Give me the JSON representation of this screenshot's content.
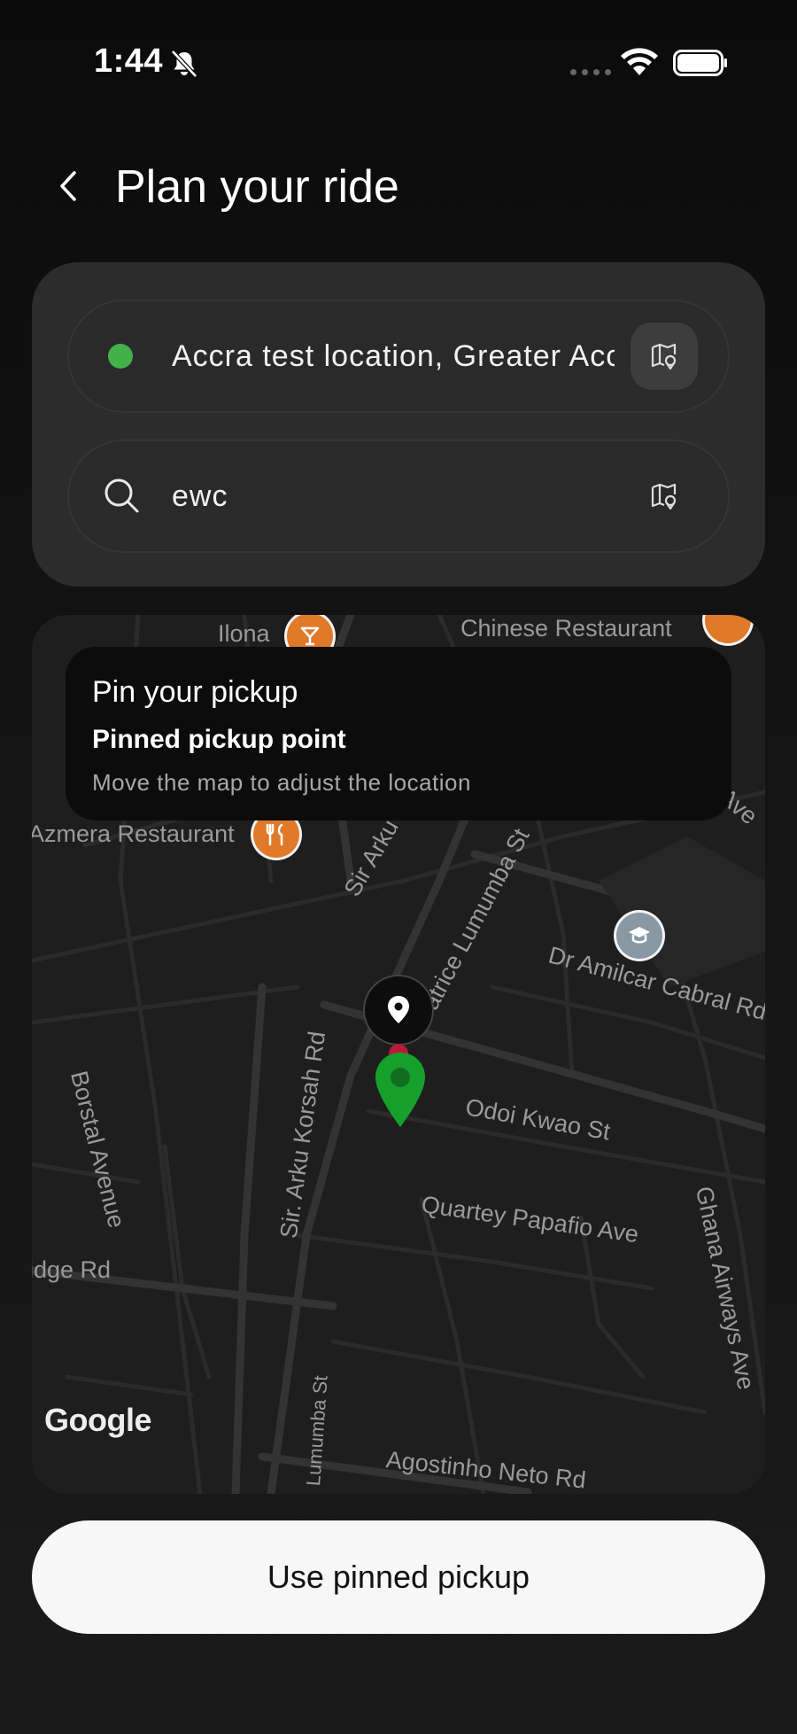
{
  "status_bar": {
    "time": "1:44",
    "icons": [
      "bell-off-icon",
      "signal-dots-icon",
      "wifi-icon",
      "battery-icon"
    ]
  },
  "header": {
    "title": "Plan your ride",
    "back_icon": "chevron-left-icon"
  },
  "pickup_field": {
    "value": "Accra test location, Greater Accra",
    "indicator_color": "#43b14a",
    "map_button_icon": "map-pin-icon"
  },
  "destination_field": {
    "value": "ewc",
    "leading_icon": "search-icon",
    "map_button_icon": "map-pin-icon"
  },
  "map": {
    "info_card": {
      "title": "Pin your pickup",
      "subtitle": "Pinned pickup point",
      "hint": "Move the map to adjust the location"
    },
    "labels": {
      "ilona": "Ilona",
      "chinese_restaurant": "Chinese Restaurant",
      "azmera_restaurant": "Azmera Restaurant",
      "sir_arku_korsah_rd": "Sir Arku Korsah Rd",
      "sir_arku_korsah_rd_2": "Sir. Arku Korsah Rd",
      "patrice_lumumba_st": "Patrice Lumumba St",
      "lumumba_st": "Lumumba St",
      "dr_amilcar_cabral_rd": "Dr Amilcar Cabral Rd",
      "odoi_kwao_st": "Odoi Kwao St",
      "borstal_avenue": "Borstal Avenue",
      "quartey_papafio_ave": "Quartey Papafio Ave",
      "ghana_airways_ave": "Ghana Airways Ave",
      "idge_rd": "idge Rd",
      "agostinho_neto_rd": "Agostinho Neto Rd",
      "dreka_ave": "Dreka Ave"
    },
    "attribution": "Google",
    "colors": {
      "background": "#1e1e1e",
      "roads": "#2b2b2b",
      "major_roads": "#333333",
      "poi_orange": "#e07a2a",
      "poi_grey": "#8a98a4",
      "pin_green": "#15a02c",
      "pin_red": "#b8193b"
    }
  },
  "cta": {
    "label": "Use pinned pickup"
  }
}
